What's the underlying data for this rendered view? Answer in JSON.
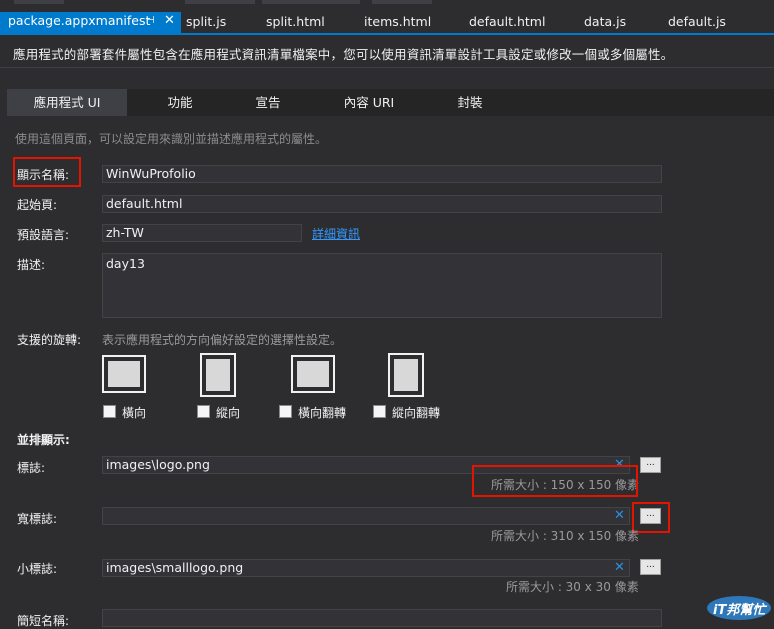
{
  "doc_tabs": {
    "active": "package.appxmanifest",
    "pin_icon": "pin-icon",
    "others": [
      "split.js",
      "split.html",
      "items.html",
      "default.html",
      "data.js",
      "default.js"
    ]
  },
  "description": "應用程式的部署套件屬性包含在應用程式資訊清單檔案中，您可以使用資訊清單設計工具設定或修改一個或多個屬性。",
  "category_tabs": [
    "應用程式 UI",
    "功能",
    "宣告",
    "內容 URI",
    "封裝"
  ],
  "subdescription": "使用這個頁面，可以設定用來識別並描述應用程式的屬性。",
  "fields": {
    "display_name": {
      "label": "顯示名稱:",
      "value": "WinWuProfolio"
    },
    "start_page": {
      "label": "起始頁:",
      "value": "default.html"
    },
    "default_language": {
      "label": "預設語言:",
      "value": "zh-TW",
      "link": "詳細資訊"
    },
    "description": {
      "label": "描述:",
      "value": "day13"
    }
  },
  "rotation": {
    "label": "支援的旋轉:",
    "hint": "表示應用程式的方向偏好設定的選擇性設定。",
    "options": [
      "橫向",
      "縱向",
      "橫向翻轉",
      "縱向翻轉"
    ]
  },
  "tile": {
    "section_label": "並排顯示:",
    "logo": {
      "label": "標誌:",
      "value": "images\\logo.png",
      "size_hint": "所需大小 : 150 x 150 像素"
    },
    "wide_logo": {
      "label": "寬標誌:",
      "value": "",
      "size_hint": "所需大小 : 310 x 150 像素"
    },
    "small_logo": {
      "label": "小標誌:",
      "value": "images\\smalllogo.png",
      "size_hint": "所需大小 : 30 x 30 像素"
    },
    "short_name": {
      "label": "簡短名稱:",
      "value": ""
    },
    "browse_label": "...",
    "clear_glyph": "✕"
  },
  "watermark": {
    "text": "iT邦幫忙"
  },
  "colors": {
    "accent": "#007acc",
    "highlight": "#e51400",
    "link": "#3399ff"
  }
}
